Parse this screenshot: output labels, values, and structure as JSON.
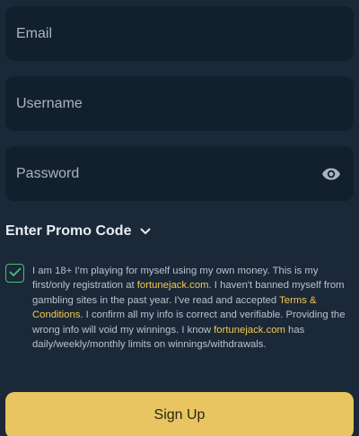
{
  "form": {
    "email": {
      "placeholder": "Email",
      "value": ""
    },
    "username": {
      "placeholder": "Username",
      "value": ""
    },
    "password": {
      "placeholder": "Password",
      "value": ""
    }
  },
  "promo": {
    "label": "Enter Promo Code"
  },
  "consent": {
    "checked": true,
    "text_1": "I am 18+ I'm playing for myself using my own money. This is my first/only registration at ",
    "link_site_1": "fortunejack.com",
    "text_2": ". I haven't banned myself from gambling sites in the past year. I've read and accepted ",
    "link_terms": "Terms & Conditions.",
    "text_3": " I confirm all my info is correct and verifiable. Providing the wrong info will void my winnings. I know ",
    "link_site_2": "fortunejack.com",
    "text_4": " has daily/weekly/monthly limits on winnings/withdrawals."
  },
  "signup": {
    "label": "Sign Up"
  },
  "colors": {
    "background": "#1b2837",
    "field": "#12202e",
    "accent_yellow": "#e8c560",
    "link_yellow": "#f3c94e",
    "check_green": "#49c17a"
  },
  "icons": {
    "password_toggle": "eye-icon",
    "promo_toggle": "chevron-down-icon",
    "checkbox_mark": "checkmark-icon"
  }
}
